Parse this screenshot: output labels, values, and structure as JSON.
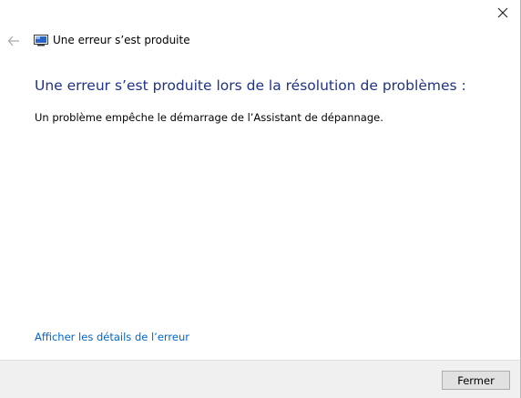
{
  "titlebar": {
    "close_icon": "close-icon"
  },
  "nav": {
    "back_icon": "back-arrow-icon",
    "app_icon": "troubleshooter-icon",
    "title": "Une erreur s’est produite"
  },
  "content": {
    "headline": "Une erreur s’est produite lors de la résolution de problèmes :",
    "message": "Un problème empêche le démarrage de l’Assistant de dépannage.",
    "details_link": "Afficher les détails de l’erreur"
  },
  "footer": {
    "close_button_label": "Fermer"
  },
  "colors": {
    "headline": "#1e3287",
    "link": "#0066cc",
    "footer_bg": "#f0f0f0"
  }
}
